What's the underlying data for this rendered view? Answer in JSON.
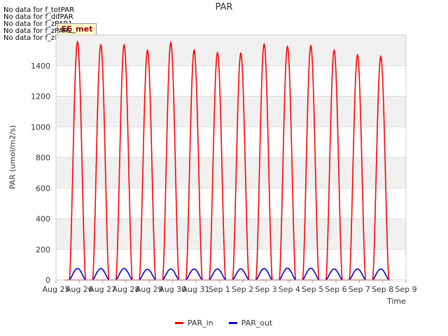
{
  "nodata_messages": [
    "No data for f_totPAR",
    "No data for f_difPAR",
    "No data for f_zPAR1",
    "No data for f_zPAR2",
    "No data for f_zPAR3"
  ],
  "site_badge": "EE_met",
  "colors": {
    "par_in": "#ff0000",
    "par_out": "#0000cc",
    "band": "#f0f0f0",
    "grid": "#dddddd"
  },
  "chart_data": {
    "type": "line",
    "title": "PAR",
    "xlabel": "Time",
    "ylabel": "PAR (umol/m2/s)",
    "x_tick_labels": [
      "Aug 25",
      "Aug 26",
      "Aug 27",
      "Aug 28",
      "Aug 29",
      "Aug 30",
      "Aug 31",
      "Sep 1",
      "Sep 2",
      "Sep 3",
      "Sep 4",
      "Sep 5",
      "Sep 6",
      "Sep 7",
      "Sep 8",
      "Sep 9"
    ],
    "xlim_days": [
      0,
      15
    ],
    "ylim": [
      0,
      1600
    ],
    "y_ticks": [
      0,
      200,
      400,
      600,
      800,
      1000,
      1200,
      1400
    ],
    "legend_position": "bottom-center",
    "series": [
      {
        "name": "PAR_in",
        "daily_peaks": [
          1555,
          1535,
          1535,
          1500,
          1550,
          1500,
          1485,
          1480,
          1540,
          1525,
          1530,
          1500,
          1470,
          1460
        ]
      },
      {
        "name": "PAR_out",
        "daily_peaks": [
          75,
          75,
          75,
          70,
          72,
          72,
          72,
          72,
          75,
          77,
          77,
          72,
          72,
          72
        ]
      }
    ]
  }
}
